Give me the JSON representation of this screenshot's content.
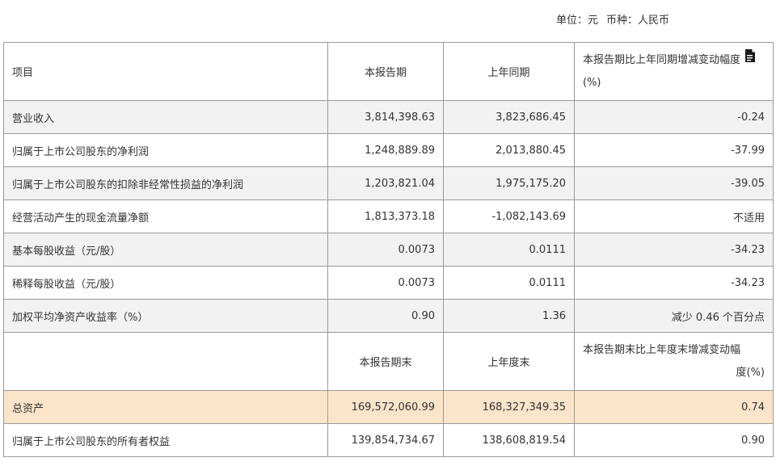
{
  "header": {
    "unit": "单位：元",
    "currency": "币种：人民币"
  },
  "columns": {
    "item": "项目",
    "current": "本报告期",
    "prior": "上年同期",
    "change_line1": "本报告期比上年同期增减变动幅度",
    "change_line2": "(%)"
  },
  "rows": [
    {
      "label": "营业收入",
      "current": "3,814,398.63",
      "prior": "3,823,686.45",
      "change": "-0.24"
    },
    {
      "label": "归属于上市公司股东的净利润",
      "current": "1,248,889.89",
      "prior": "2,013,880.45",
      "change": "-37.99"
    },
    {
      "label": "归属于上市公司股东的扣除非经常性损益的净利润",
      "current": "1,203,821.04",
      "prior": "1,975,175.20",
      "change": "-39.05"
    },
    {
      "label": "经营活动产生的现金流量净额",
      "current": "1,813,373.18",
      "prior": "-1,082,143.69",
      "change": "不适用"
    },
    {
      "label": "基本每股收益（元/股）",
      "current": "0.0073",
      "prior": "0.0111",
      "change": "-34.23"
    },
    {
      "label": "稀释每股收益（元/股）",
      "current": "0.0073",
      "prior": "0.0111",
      "change": "-34.23"
    },
    {
      "label": "加权平均净资产收益率（%）",
      "current": "0.90",
      "prior": "1.36",
      "change": "减少 0.46 个百分点"
    }
  ],
  "columns2": {
    "item": "",
    "current": "本报告期末",
    "prior": "上年度末",
    "change_line1": "本报告期末比上年度末增减变动幅",
    "change_line2": "度(%)"
  },
  "rows2": [
    {
      "label": "总资产",
      "current": "169,572,060.99",
      "prior": "168,327,349.35",
      "change": "0.74"
    },
    {
      "label": "归属于上市公司股东的所有者权益",
      "current": "139,854,734.67",
      "prior": "138,608,819.54",
      "change": "0.90"
    }
  ],
  "icons": {
    "doc": "document-icon"
  }
}
